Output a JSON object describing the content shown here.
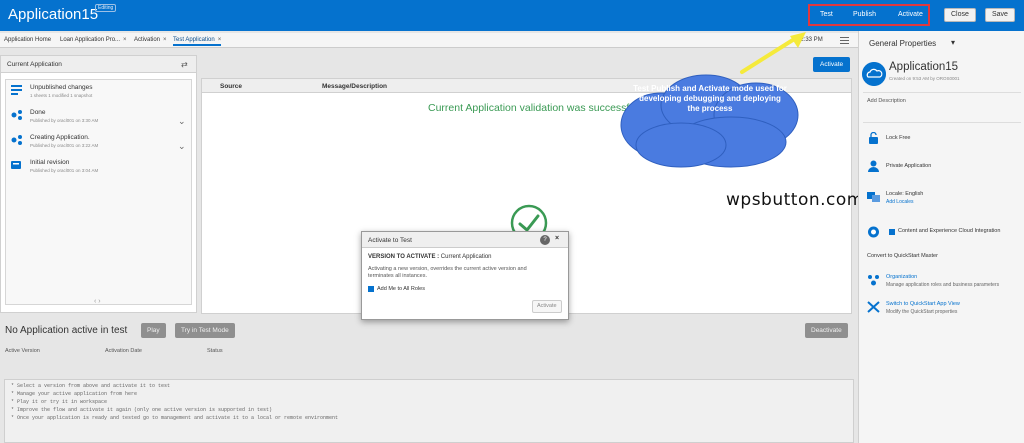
{
  "app": {
    "title": "Application15",
    "badge": "Editing"
  },
  "toolbar": {
    "test": "Test",
    "publish": "Publish",
    "activate": "Activate",
    "close": "Close",
    "save": "Save"
  },
  "tabs": [
    {
      "label": "Application Home",
      "close": ""
    },
    {
      "label": "Loan Application Pro...",
      "close": "×"
    },
    {
      "label": "Activation",
      "close": "×"
    },
    {
      "label": "Test Application",
      "close": "×"
    }
  ],
  "tabbar_right": "1 12:33 PM",
  "left_panel": {
    "header": "Current Application",
    "revisions": [
      {
        "title": "Unpublished changes",
        "sub": "1 sheets 1 modified 1 snapshot"
      },
      {
        "title": "Done",
        "sub": "Published by oracl001 on 3:30 AM"
      },
      {
        "title": "Creating Application.",
        "sub": "Published by oracl001 on 3:22 AM"
      },
      {
        "title": "Initial revision",
        "sub": "Published by oracl001 on 3:04 AM"
      }
    ]
  },
  "center": {
    "col_source": "Source",
    "col_message": "Message/Description",
    "validation_message": "Current Application validation was successful",
    "activate_button": "Activate",
    "watermark": "wpsbutton.com"
  },
  "annotation": {
    "text": "Test Publish and Activate mode used for developing debugging and deploying the process"
  },
  "dialog": {
    "title": "Activate to Test",
    "help": "?",
    "close": "×",
    "version_label": "VERSION TO ACTIVATE :",
    "version_value": "Current Application",
    "info": "Activating a new version, overrides the current active version and terminates all instances.",
    "checkbox_label": "Add Me to All Roles",
    "activate_button": "Activate"
  },
  "test_section": {
    "title": "No Application active in test",
    "play_button": "Play",
    "try_button": "Try in Test Mode",
    "deactivate_button": "Deactivate",
    "columns": [
      "Active Version",
      "Activation Date",
      "Status"
    ]
  },
  "notes": [
    "* Select a version from above and activate it to test",
    "* Manage your active application from here",
    "* Play it or try it in workspace",
    "* Improve the flow and activate it again (only one active version is supported in test)",
    "* Once your application is ready and tested go to management and activate it to a local or remote environment"
  ],
  "right_panel": {
    "title": "General Properties",
    "app_name": "Application15",
    "app_sub": "Created on 9:53 AM by OROS0001",
    "add_description": "Add Description",
    "lock_free": "Lock Free",
    "private_application": "Private Application",
    "locale": "Locale: English",
    "add_locales": "Add Locales",
    "content_integration": "Content and Experience Cloud Integration",
    "convert": "Convert to QuickStart Master",
    "organization": "Organization",
    "organization_sub": "Manage application roles and business parameters",
    "quickstart": "Switch to QuickStart App View",
    "quickstart_sub": "Modify the QuickStart properties"
  },
  "colors": {
    "brand_blue": "#0572ce",
    "success_green": "#3a9a54",
    "highlight_red": "#e0383e",
    "annotation_cloud": "#4a7be0",
    "arrow_yellow": "#f5ea3b"
  }
}
